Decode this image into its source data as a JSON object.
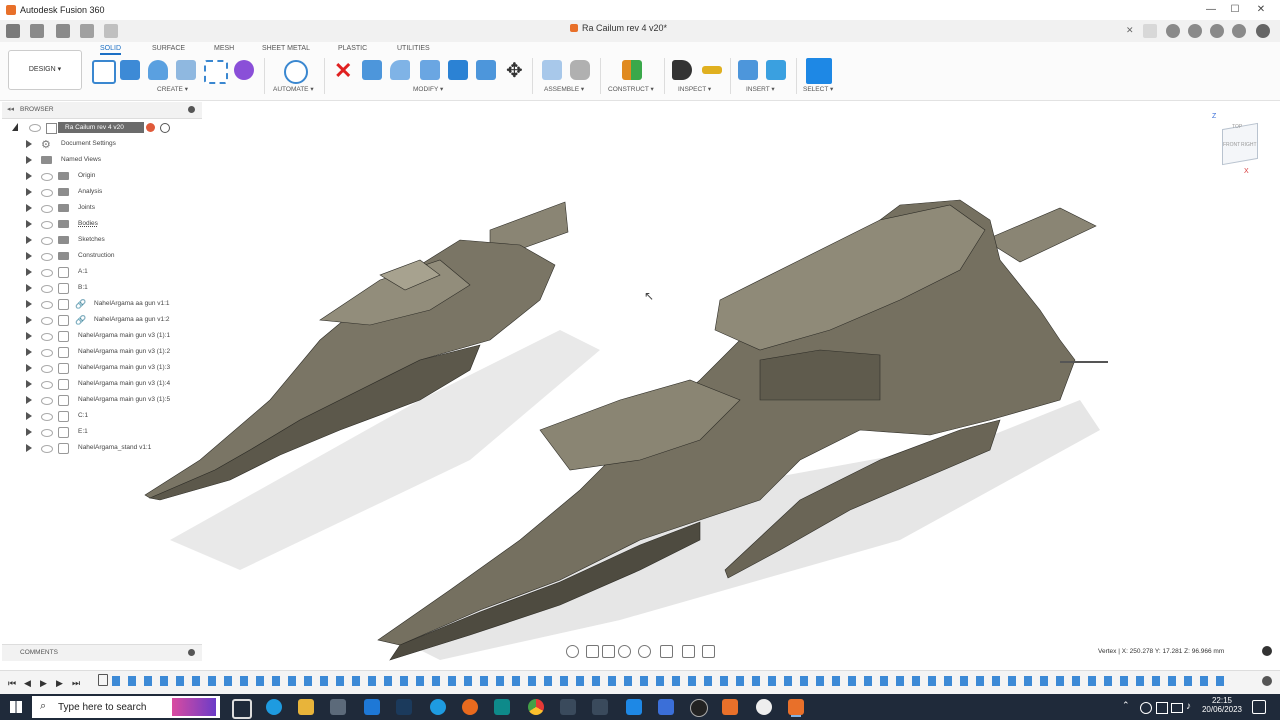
{
  "window": {
    "app_title": "Autodesk Fusion 360",
    "min": "—",
    "max": "☐",
    "close": "✕"
  },
  "tabbar": {
    "document_tab": "Ra Cailum rev 4 v20*",
    "close_tab": "✕"
  },
  "ribbon": {
    "tabs": [
      "SOLID",
      "SURFACE",
      "MESH",
      "SHEET METAL",
      "PLASTIC",
      "UTILITIES"
    ],
    "active_tab": "SOLID",
    "workspace": "DESIGN ▾",
    "groups": [
      "CREATE ▾",
      "AUTOMATE ▾",
      "MODIFY ▾",
      "ASSEMBLE ▾",
      "CONSTRUCT ▾",
      "INSPECT ▾",
      "INSERT ▾",
      "SELECT ▾"
    ]
  },
  "browser": {
    "header": "BROWSER",
    "root": "Ra Cailum rev 4 v20",
    "items": [
      "Document Settings",
      "Named Views",
      "Origin",
      "Analysis",
      "Joints",
      "Bodies",
      "Sketches",
      "Construction",
      "A:1",
      "B:1",
      "NahelArgama aa gun v1:1",
      "NahelArgama aa gun v1:2",
      "NahelArgama main gun v3 (1):1",
      "NahelArgama main gun v3 (1):2",
      "NahelArgama main gun v3 (1):3",
      "NahelArgama main gun v3 (1):4",
      "NahelArgama main gun v3 (1):5",
      "C:1",
      "E:1",
      "NahelArgama_stand v1:1"
    ]
  },
  "comments": {
    "header": "COMMENTS"
  },
  "status": {
    "vertex": "Vertex | X: 250.278 Y: 17.281 Z: 96.966 mm"
  },
  "viewcube": {
    "top": "TOP",
    "front": "FRONT",
    "right": "RIGHT",
    "z": "Z",
    "x": "X"
  },
  "taskbar": {
    "search_placeholder": "Type here to search",
    "time": "22:15",
    "date": "20/06/2023"
  },
  "colors": {
    "accent": "#1b6fc4",
    "brand": "#e8702a",
    "model": "#6e6a5c",
    "taskbar": "#1f2a3a"
  }
}
